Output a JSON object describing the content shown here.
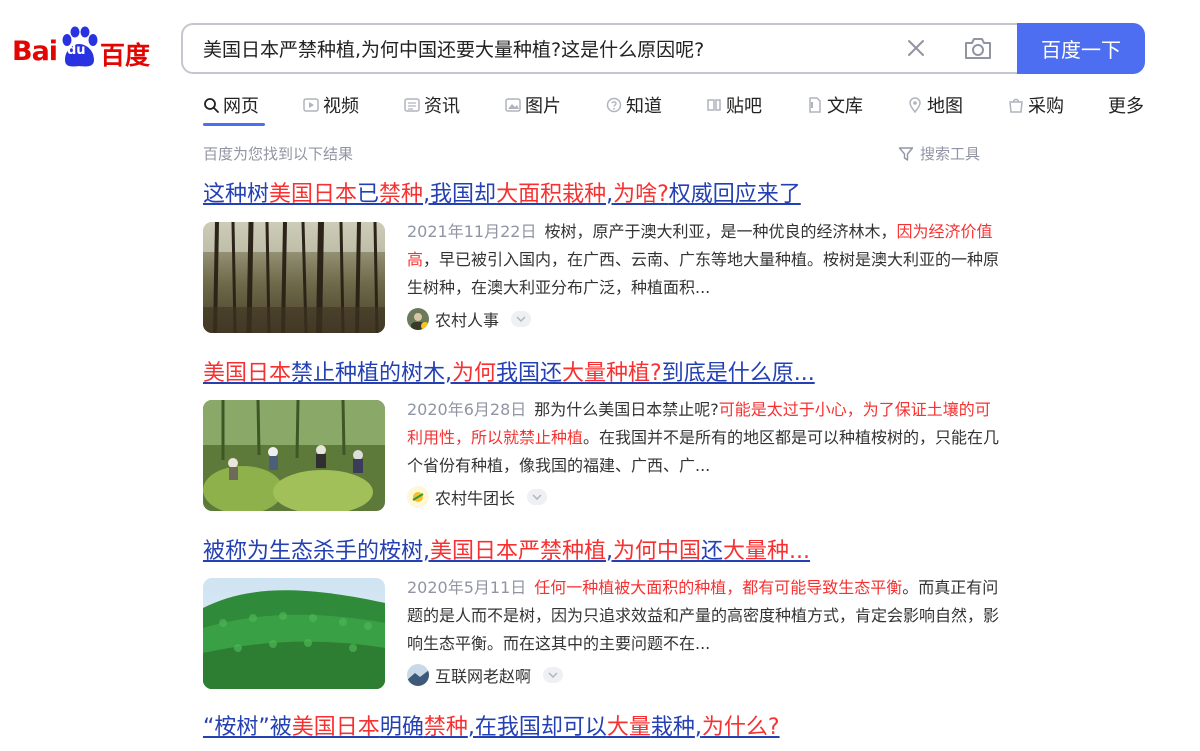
{
  "logo": {
    "text_left": "Bai",
    "text_du": "du",
    "text_right": "百度"
  },
  "search": {
    "query": "美国日本严禁种植,为何中国还要大量种植?这是什么原因呢?",
    "button": "百度一下"
  },
  "tabs": [
    {
      "label": "网页",
      "icon": "search-icon"
    },
    {
      "label": "视频",
      "icon": "video-icon"
    },
    {
      "label": "资讯",
      "icon": "news-icon"
    },
    {
      "label": "图片",
      "icon": "image-icon"
    },
    {
      "label": "知道",
      "icon": "question-icon"
    },
    {
      "label": "贴吧",
      "icon": "tieba-icon"
    },
    {
      "label": "文库",
      "icon": "doc-icon"
    },
    {
      "label": "地图",
      "icon": "map-icon"
    },
    {
      "label": "采购",
      "icon": "shopping-icon"
    },
    {
      "label": "更多",
      "icon": ""
    }
  ],
  "result_count": "百度为您找到以下结果",
  "search_tools": "搜索工具",
  "results": [
    {
      "title": [
        {
          "t": "这种树",
          "hl": false
        },
        {
          "t": "美国日本",
          "hl": true
        },
        {
          "t": "已",
          "hl": false
        },
        {
          "t": "禁种",
          "hl": true
        },
        {
          "t": ",我国却",
          "hl": false
        },
        {
          "t": "大面积栽种",
          "hl": true
        },
        {
          "t": ",",
          "hl": false
        },
        {
          "t": "为啥?",
          "hl": true
        },
        {
          "t": "权威回应来了",
          "hl": false
        }
      ],
      "date": "2021年11月22日",
      "abstract": [
        {
          "t": "桉树，原产于澳大利亚，是一种优良的经济林木，",
          "hl": false
        },
        {
          "t": "因为经济价值高",
          "hl": true
        },
        {
          "t": "，早已被引入国内，在广西、云南、广东等地大量种植。桉树是澳大利亚的一种原生树种，在澳大利亚分布广泛，种植面积...",
          "hl": false
        }
      ],
      "source": "农村人事"
    },
    {
      "title": [
        {
          "t": "美国日本",
          "hl": true
        },
        {
          "t": "禁止种植的树木,",
          "hl": false
        },
        {
          "t": "为何",
          "hl": true
        },
        {
          "t": "我国还",
          "hl": false
        },
        {
          "t": "大量种植?",
          "hl": true
        },
        {
          "t": "到底是什么原...",
          "hl": false
        }
      ],
      "date": "2020年6月28日",
      "abstract": [
        {
          "t": "那为什么美国日本禁止呢?",
          "hl": false
        },
        {
          "t": "可能是太过于小心，为了保证土壤的可利用性，所以就禁止种植",
          "hl": true
        },
        {
          "t": "。在我国并不是所有的地区都是可以种植桉树的，只能在几个省份有种植，像我国的福建、广西、广...",
          "hl": false
        }
      ],
      "source": "农村牛团长"
    },
    {
      "title": [
        {
          "t": "被称为生态杀手的桉树,",
          "hl": false
        },
        {
          "t": "美国日本严禁种植",
          "hl": true
        },
        {
          "t": ",",
          "hl": false
        },
        {
          "t": "为何中国",
          "hl": true
        },
        {
          "t": "还",
          "hl": false
        },
        {
          "t": "大量种...",
          "hl": true
        }
      ],
      "date": "2020年5月11日",
      "abstract": [
        {
          "t": "任何一种植被大面积的种植，都有可能导致生态平衡",
          "hl": true
        },
        {
          "t": "。而真正有问题的是人而不是树，因为只追求效益和产量的高密度种植方式，肯定会影响自然，影响生态平衡。而在这其中的主要问题不在...",
          "hl": false
        }
      ],
      "source": "互联网老赵啊"
    },
    {
      "title": [
        {
          "t": "“桉树”被",
          "hl": false
        },
        {
          "t": "美国日本",
          "hl": true
        },
        {
          "t": "明确",
          "hl": false
        },
        {
          "t": "禁种",
          "hl": true
        },
        {
          "t": ",在我国却可以",
          "hl": false
        },
        {
          "t": "大量",
          "hl": true
        },
        {
          "t": "栽种",
          "hl": false
        },
        {
          "t": ",",
          "hl": false
        },
        {
          "t": "为什么?",
          "hl": true
        }
      ]
    }
  ],
  "colors": {
    "brand_blue": "#4e6ef2",
    "link": "#2440b3",
    "highlight": "#f73131",
    "logo_red": "#e10601"
  }
}
